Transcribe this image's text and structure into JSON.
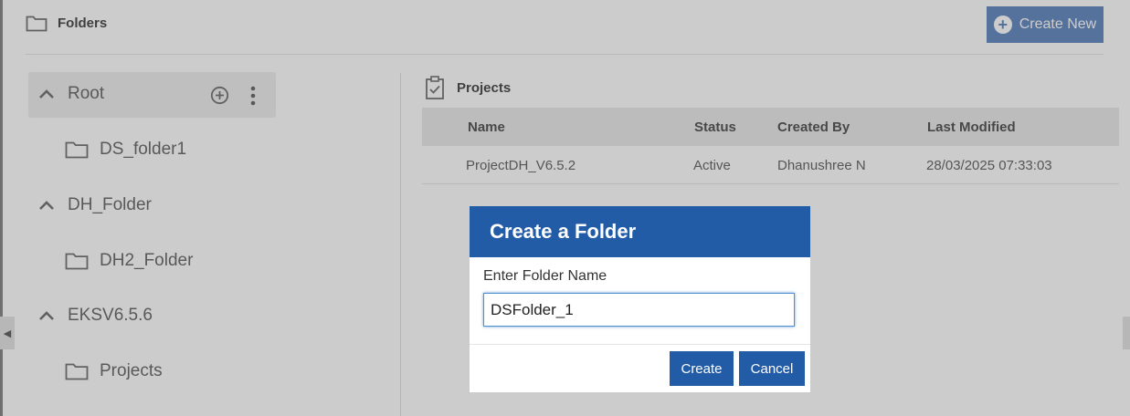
{
  "header": {
    "title": "Folders",
    "create_new_label": "Create New"
  },
  "tree": [
    {
      "label": "Root",
      "type": "parent"
    },
    {
      "label": "DS_folder1",
      "type": "child"
    },
    {
      "label": "DH_Folder",
      "type": "parent"
    },
    {
      "label": "DH2_Folder",
      "type": "child"
    },
    {
      "label": "EKSV6.5.6",
      "type": "parent"
    },
    {
      "label": "Projects",
      "type": "child"
    }
  ],
  "projects": {
    "title": "Projects",
    "columns": [
      "Name",
      "Status",
      "Created By",
      "Last Modified"
    ],
    "rows": [
      [
        "ProjectDH_V6.5.2",
        "Active",
        "Dhanushree N",
        "28/03/2025 07:33:03"
      ]
    ]
  },
  "dialog": {
    "title": "Create a Folder",
    "label": "Enter Folder Name",
    "input_value": "DSFolder_1",
    "create_label": "Create",
    "cancel_label": "Cancel"
  },
  "colors": {
    "primary": "#235ca6",
    "accent_faded": "#6b8fc4"
  },
  "icons": {
    "header": "folder-icon",
    "projects": "clipboard-check-icon",
    "add": "plus-circle-icon",
    "more": "more-vertical-icon",
    "expand": "chevron-up-icon",
    "folder": "folder-icon"
  }
}
